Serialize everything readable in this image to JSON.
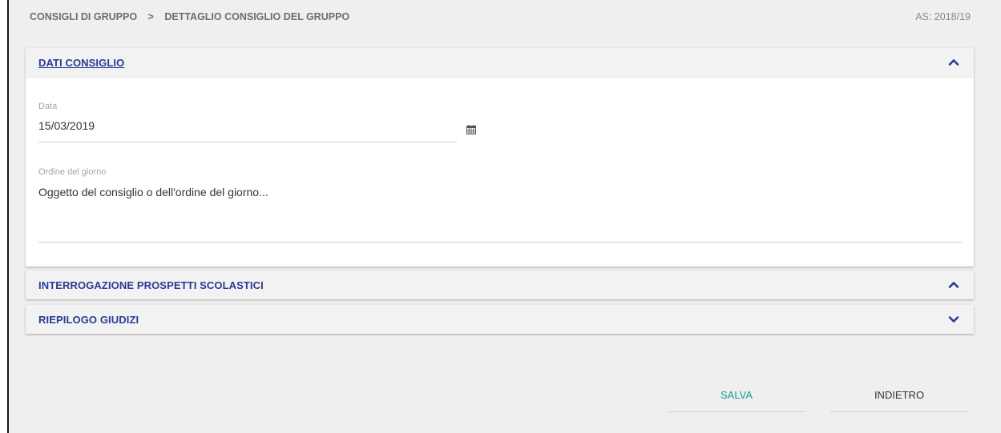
{
  "breadcrumb": {
    "parent": "CONSIGLI DI GRUPPO",
    "separator": ">",
    "current": "DETTAGLIO CONSIGLIO DEL GRUPPO"
  },
  "school_year": "AS: 2018/19",
  "panels": {
    "dati_consiglio": {
      "title": "DATI CONSIGLIO",
      "expanded": true,
      "date_label": "Data",
      "date_value": "15/03/2019",
      "agenda_label": "Ordine del giorno",
      "agenda_placeholder": "Oggetto del consiglio o dell'ordine del giorno..."
    },
    "interrogazione": {
      "title": "INTERROGAZIONE PROSPETTI SCOLASTICI",
      "expanded": true
    },
    "riepilogo": {
      "title": "RIEPILOGO GIUDIZI",
      "expanded": false
    }
  },
  "actions": {
    "save_label": "SALVA",
    "back_label": "INDIETRO"
  },
  "colors": {
    "accent": "#2b3a93",
    "save": "#1f9a87",
    "background": "#efefef"
  },
  "icons": {
    "chevron_up": "chevron-up-icon",
    "chevron_down": "chevron-down-icon",
    "calendar": "calendar-icon"
  }
}
